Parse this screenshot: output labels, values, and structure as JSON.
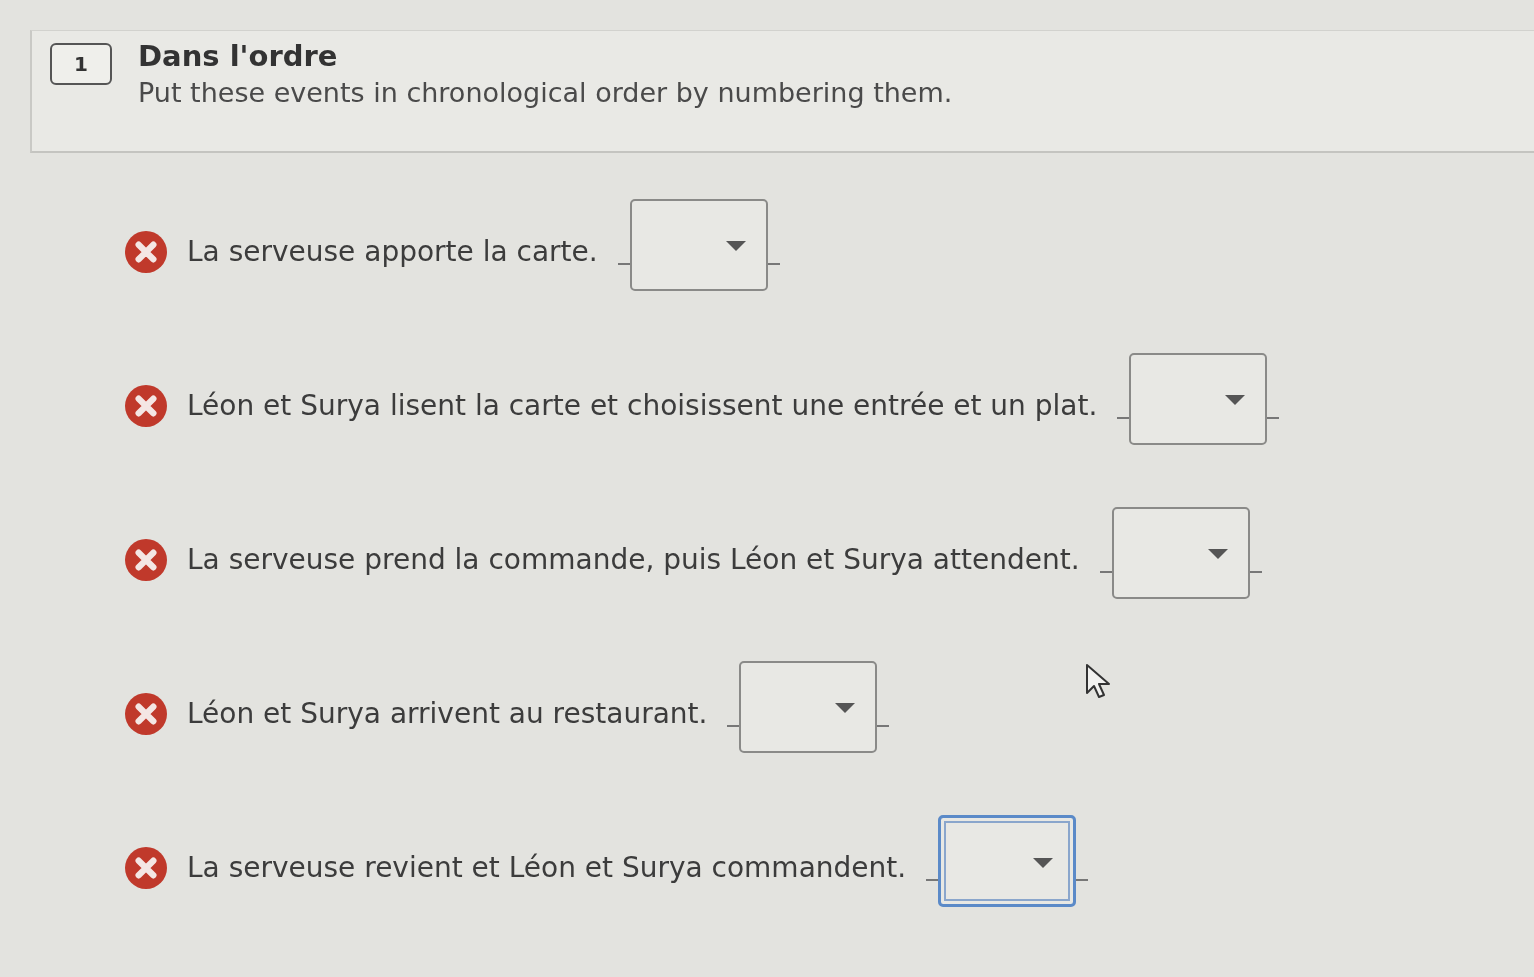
{
  "question": {
    "number": "1",
    "title": "Dans l'ordre",
    "instruction": "Put these events in chronological order by numbering them."
  },
  "items": [
    {
      "text": "La serveuse apporte la carte.",
      "correct": false,
      "focused": false
    },
    {
      "text": "Léon et Surya lisent la carte et choisissent une entrée et un plat.",
      "correct": false,
      "focused": false
    },
    {
      "text": "La serveuse prend la commande, puis Léon et Surya attendent.",
      "correct": false,
      "focused": false
    },
    {
      "text": "Léon et Surya arrivent au restaurant.",
      "correct": false,
      "focused": false
    },
    {
      "text": "La serveuse revient et Léon et Surya commandent.",
      "correct": false,
      "focused": true
    }
  ]
}
